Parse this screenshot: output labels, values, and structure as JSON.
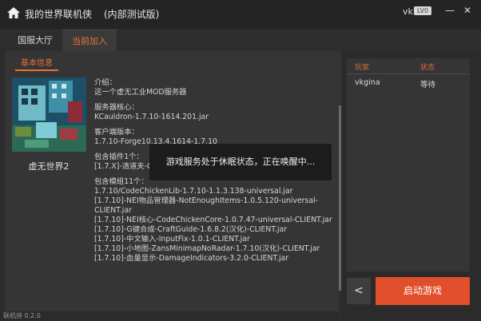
{
  "titlebar": {
    "app_name": "我的世界联机侠",
    "edition": "(内部测试版)",
    "user": "vk",
    "level": "LV0",
    "minimize_glyph": "—",
    "close_glyph": "✕",
    "icon": "home-icon"
  },
  "tabs": [
    {
      "label": "国服大厅"
    },
    {
      "label": "当前加入"
    }
  ],
  "main": {
    "basic_info_tab": "基本信息",
    "server_name": "虚无世界2",
    "intro_label": "介绍：",
    "intro": "这一个虚无工业MOD服务器",
    "core_label": "服务器核心：",
    "core": "KCauldron-1.7.10-1614.201.jar",
    "client_label": "客户端版本：",
    "client": "1.7.10-Forge10.13.4.1614-1.7.10",
    "plugins_label": "包含插件1个：",
    "plugins": [
      "[1.7.X]-清道夫-ClearLag-2.9.3.jar"
    ],
    "mods_label": "包含模组11个：",
    "mods": [
      "1.7.10/CodeChickenLib-1.7.10-1.1.3.138-universal.jar",
      "[1.7.10]-NEI物品管理器-NotEnoughItems-1.0.5.120-universal-CLIENT.jar",
      "[1.7.10]-NEI核心-CodeChickenCore-1.0.7.47-universal-CLIENT.jar",
      "[1.7.10]-G键合成-CraftGuide-1.6.8.2(汉化)-CLIENT.jar",
      "[1.7.10]-中文输入-InputFix-1.0.1-CLIENT.jar",
      "[1.7.10]-小地图-ZansMinimapNoRadar-1.7.10(汉化)-CLIENT.jar",
      "[1.7.10]-血量显示-DamageIndicators-3.2.0-CLIENT.jar"
    ]
  },
  "toast": "游戏服务处于休眠状态，正在唤醒中...",
  "players": {
    "col_player": "玩家",
    "col_status": "状态",
    "rows": [
      {
        "name": "vkgina",
        "status": "等待"
      }
    ]
  },
  "actions": {
    "back": "<",
    "start": "启动游戏"
  },
  "footer": {
    "version": "联机侠 0.2.0"
  },
  "colors": {
    "accent": "#e8723b",
    "start_button": "#e04e2b",
    "background": "#2b2b2b"
  }
}
